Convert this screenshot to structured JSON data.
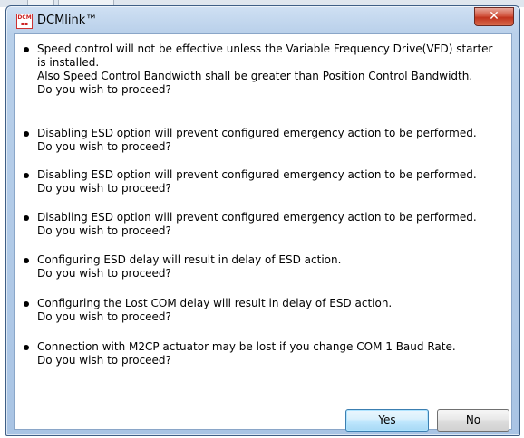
{
  "window": {
    "title": "DCMlink™",
    "icon_lines": [
      "DCM",
      "▪▪"
    ],
    "close_glyph": "✕"
  },
  "messages": [
    {
      "lines": [
        "Speed control will not be effective unless the Variable Frequency Drive(VFD) starter",
        "is installed.",
        "Also Speed Control Bandwidth shall be greater than Position Control Bandwidth.",
        "Do you wish to proceed?"
      ]
    },
    {
      "lines": [
        "Disabling ESD option will prevent configured emergency action to be performed.",
        "Do you wish to proceed?"
      ]
    },
    {
      "lines": [
        "Disabling ESD option will prevent configured emergency action to be performed.",
        "Do you wish to proceed?"
      ]
    },
    {
      "lines": [
        "Disabling ESD option will prevent configured emergency action to be performed.",
        "Do you wish to proceed?"
      ]
    },
    {
      "lines": [
        "Configuring ESD delay will result in delay of ESD action.",
        "Do you wish to proceed?"
      ]
    },
    {
      "lines": [
        "Configuring the Lost COM delay will result in delay of ESD action.",
        "Do you wish to proceed?"
      ]
    },
    {
      "lines": [
        "Connection with M2CP actuator may be lost if you change COM 1 Baud Rate.",
        "Do you wish to proceed?"
      ]
    }
  ],
  "buttons": {
    "yes_label": "Yes",
    "no_label": "No"
  }
}
